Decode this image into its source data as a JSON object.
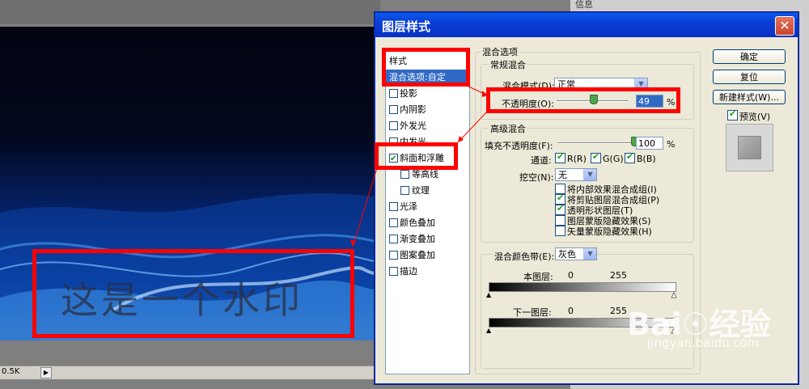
{
  "background": {
    "status_zoom": "0.5K",
    "right_panel_tab": "信息"
  },
  "watermark_text": "这是一个水印",
  "baidu": {
    "logo": "Bai☉经验",
    "url": "jingyan.baidu.com"
  },
  "dialog": {
    "title": "图层样式",
    "style_list": [
      {
        "label": "样式",
        "checked": false,
        "has_checkbox": false
      },
      {
        "label": "混合选项:自定",
        "selected": true
      },
      {
        "label": "投影",
        "checked": false
      },
      {
        "label": "内阴影",
        "checked": false
      },
      {
        "label": "外发光",
        "checked": false
      },
      {
        "label": "内发光",
        "checked": false
      },
      {
        "label": "斜面和浮雕",
        "checked": true
      },
      {
        "label": "等高线",
        "checked": false,
        "sub": true
      },
      {
        "label": "纹理",
        "checked": false,
        "sub": true
      },
      {
        "label": "光泽",
        "checked": false
      },
      {
        "label": "颜色叠加",
        "checked": false
      },
      {
        "label": "渐变叠加",
        "checked": false
      },
      {
        "label": "图案叠加",
        "checked": false
      },
      {
        "label": "描边",
        "checked": false
      }
    ],
    "blend_options": {
      "title": "混合选项",
      "general": {
        "title": "常规混合",
        "mode_label": "混合模式(D):",
        "mode_value": "正常",
        "opacity_label": "不透明度(O):",
        "opacity_value": "49",
        "opacity_unit": "%"
      },
      "advanced": {
        "title": "高级混合",
        "fill_label": "填充不透明度(F):",
        "fill_value": "100",
        "fill_unit": "%",
        "channels_label": "通道:",
        "channels": [
          {
            "label": "R(R)",
            "checked": true
          },
          {
            "label": "G(G)",
            "checked": true
          },
          {
            "label": "B(B)",
            "checked": true
          }
        ],
        "knockout_label": "挖空(N):",
        "knockout_value": "无",
        "options": [
          {
            "label": "将内部效果混合成组(I)",
            "checked": false
          },
          {
            "label": "将剪贴图层混合成组(P)",
            "checked": true
          },
          {
            "label": "透明形状图层(T)",
            "checked": true
          },
          {
            "label": "图层蒙版隐藏效果(S)",
            "checked": false
          },
          {
            "label": "矢量蒙版隐藏效果(H)",
            "checked": false
          }
        ]
      },
      "blend_if": {
        "label": "混合颜色带(E):",
        "value": "灰色",
        "this_layer_label": "本图层:",
        "this_layer_min": "0",
        "this_layer_max": "255",
        "under_layer_label": "下一图层:",
        "under_layer_min": "0",
        "under_layer_max": "255"
      }
    },
    "buttons": {
      "ok": "确定",
      "reset": "复位",
      "new_style": "新建样式(W)...",
      "preview": "预览(V)",
      "preview_checked": true
    }
  }
}
